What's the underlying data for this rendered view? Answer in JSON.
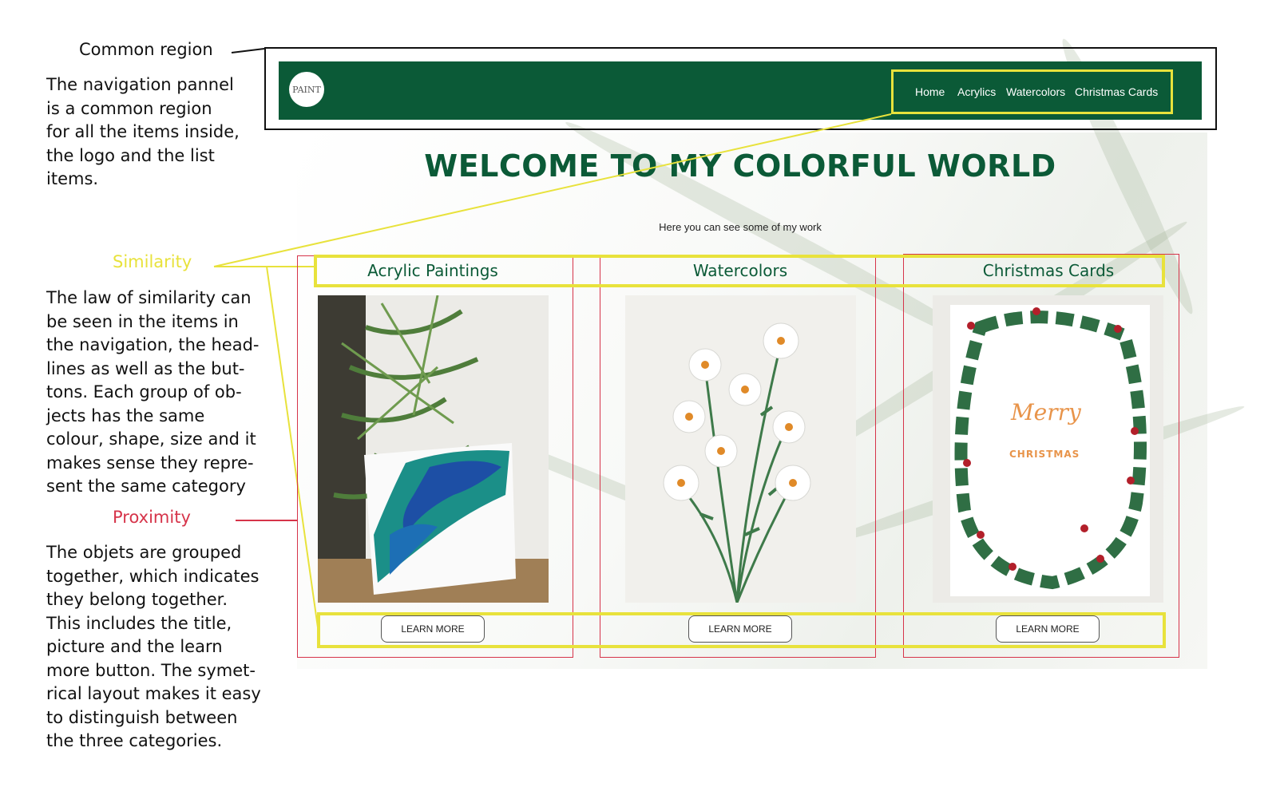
{
  "annotations": {
    "common_region": {
      "title": "Common region",
      "lines": [
        "The navigation pannel",
        "is a common region",
        "for all the items inside,",
        "the logo and the list",
        "items."
      ]
    },
    "similarity": {
      "title": "Similarity",
      "lines": [
        "The law of similarity can",
        "be seen in the items in",
        "the navigation, the head-",
        "lines as well as the but-",
        "tons. Each group of ob-",
        "jects has the same",
        "colour, shape, size and it",
        "makes sense they repre-",
        "sent the same category"
      ]
    },
    "proximity": {
      "title": "Proximity",
      "lines": [
        "The objets are grouped",
        "together, which indicates",
        "they belong together.",
        "This includes the title,",
        "picture and the learn",
        "more button. The symet-",
        "rical layout makes it easy",
        "to distinguish between",
        "the three categories."
      ]
    }
  },
  "site": {
    "logo_text": "PAINT",
    "nav": [
      "Home",
      "Acrylics",
      "Watercolors",
      "Christmas Cards"
    ],
    "headline": "WELCOME TO MY COLORFUL WORLD",
    "subline": "Here you can see some of my work",
    "cards": [
      {
        "title": "Acrylic Paintings",
        "button": "LEARN MORE"
      },
      {
        "title": "Watercolors",
        "button": "LEARN MORE"
      },
      {
        "title": "Christmas Cards",
        "button": "LEARN MORE",
        "card_text_1": "Merry",
        "card_text_2": "CHRISTMAS"
      }
    ]
  },
  "colors": {
    "brand_green": "#0b5a37",
    "similarity_yellow": "#e8e23c",
    "proximity_red": "#d6344a"
  }
}
